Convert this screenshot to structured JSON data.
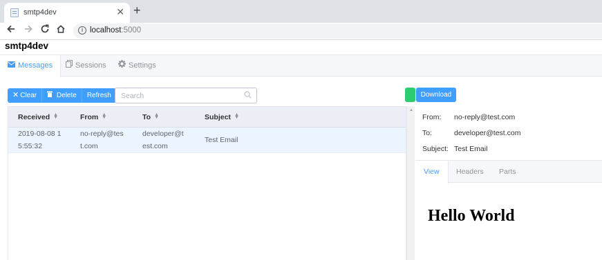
{
  "browser": {
    "tab_title": "smtp4dev",
    "close_glyph": "✕",
    "new_tab_glyph": "+",
    "url_host": "localhost",
    "url_port": ":5000",
    "icons": [
      "back-icon",
      "forward-icon",
      "reload-icon",
      "home-icon",
      "info-icon"
    ]
  },
  "app": {
    "title": "smtp4dev",
    "nav": [
      {
        "label": "Messages",
        "icon": "envelope-icon",
        "active": true
      },
      {
        "label": "Sessions",
        "icon": "copy-icon",
        "active": false
      },
      {
        "label": "Settings",
        "icon": "gear-icon",
        "active": false
      }
    ]
  },
  "messages": {
    "buttons": {
      "clear": "Clear",
      "delete": "Delete",
      "refresh": "Refresh"
    },
    "search_placeholder": "Search",
    "columns": [
      "Received",
      "From",
      "To",
      "Subject"
    ],
    "rows": [
      {
        "received_l1": "2019-08-08 1",
        "received_l2": "5:55:32",
        "from_l1": "no-reply@tes",
        "from_l2": "t.com",
        "to_l1": "developer@t",
        "to_l2": "est.com",
        "subject": "Test Email"
      }
    ]
  },
  "detail": {
    "download_label": "Download",
    "from_label": "From:",
    "from_value": "no-reply@test.com",
    "to_label": "To:",
    "to_value": "developer@test.com",
    "subject_label": "Subject:",
    "subject_value": "Test Email",
    "tabs": [
      "View",
      "Headers",
      "Parts"
    ],
    "body_heading": "Hello World"
  },
  "colors": {
    "accent": "#409eff",
    "status": "#2ecc71"
  }
}
